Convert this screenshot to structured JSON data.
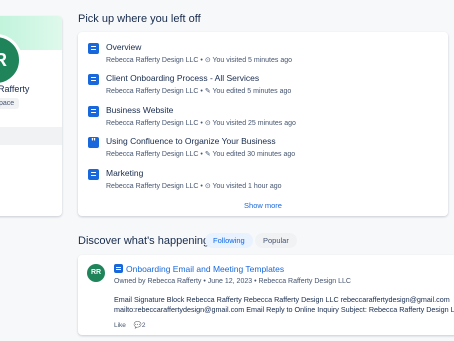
{
  "profile": {
    "initials": "R",
    "name": "Rafferty",
    "badge": "pace"
  },
  "recent": {
    "title": "Pick up where you left off",
    "items": [
      {
        "icon": "page-icon",
        "title": "Overview",
        "meta": "Rebecca Rafferty Design LLC • ⊙ You visited 5 minutes ago"
      },
      {
        "icon": "page-icon",
        "title": "Client Onboarding Process - All Services",
        "meta": "Rebecca Rafferty Design LLC • ✎ You edited 5 minutes ago"
      },
      {
        "icon": "page-icon",
        "title": "Business Website",
        "meta": "Rebecca Rafferty Design LLC • ⊙ You visited 25 minutes ago"
      },
      {
        "icon": "quote-icon",
        "title": "Using Confluence to Organize Your Business",
        "meta": "Rebecca Rafferty Design LLC • ✎ You edited 30 minutes ago"
      },
      {
        "icon": "page-icon",
        "title": "Marketing",
        "meta": "Rebecca Rafferty Design LLC • ⊙ You visited 1 hour ago"
      }
    ],
    "show_more": "Show more"
  },
  "discover": {
    "title": "Discover what's happening",
    "tabs": [
      "Following",
      "Popular"
    ],
    "active_tab": "Following"
  },
  "feed": {
    "avatar": "RR",
    "title": "Onboarding Email and Meeting Templates",
    "meta": "Owned by Rebecca Rafferty • June 12, 2023 • Rebecca Rafferty Design LLC",
    "excerpt_line1": "Email Signature Block Rebecca Rafferty Rebecca Rafferty Design LLC rebeccaraffertydesign@gmail.com",
    "excerpt_line2": "mailto:rebeccaraffertydesign@gmail.com Email Reply to Online Inquiry  Subject: Rebecca Rafferty Design LLC",
    "like": "Like",
    "comment_icon": "💬",
    "comment_count": "2"
  },
  "colors": {
    "accent": "#1868db",
    "avatar": "#1f845a",
    "banner": "#b7f2d6"
  }
}
